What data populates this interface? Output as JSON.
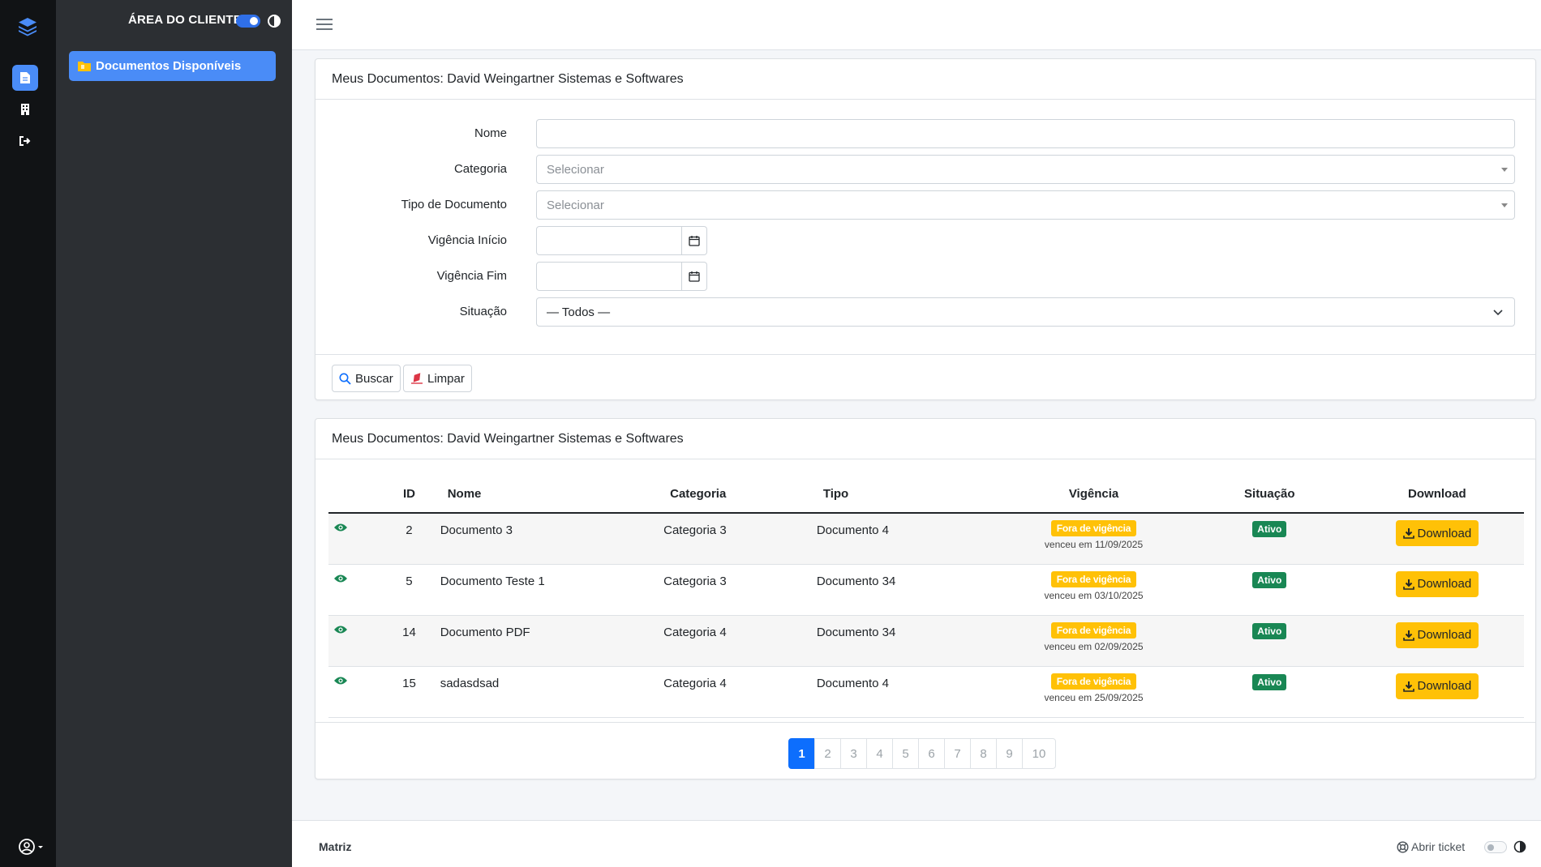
{
  "sidebar": {
    "title": "ÁREA DO CLIENTE",
    "nav_item": "Documentos Disponíveis"
  },
  "filters": {
    "header": "Meus Documentos: David Weingartner Sistemas e Softwares",
    "nome_label": "Nome",
    "nome_value": "",
    "categoria_label": "Categoria",
    "categoria_value": "Selecionar",
    "tipo_label": "Tipo de Documento",
    "tipo_value": "Selecionar",
    "vig_inicio_label": "Vigência Início",
    "vig_fim_label": "Vigência Fim",
    "situacao_label": "Situação",
    "situacao_value": "— Todos —",
    "buscar": "Buscar",
    "limpar": "Limpar"
  },
  "table": {
    "header": "Meus Documentos: David Weingartner Sistemas e Softwares",
    "columns": [
      "ID",
      "Nome",
      "Categoria",
      "Tipo",
      "Vigência",
      "Situação",
      "Download"
    ],
    "rows": [
      {
        "id": "2",
        "nome": "Documento 3",
        "categoria": "Categoria 3",
        "tipo": "Documento 4",
        "vig_badge": "Fora de vigência",
        "vig_sub": "venceu em 11/09/2025",
        "situacao": "Ativo",
        "download": "Download"
      },
      {
        "id": "5",
        "nome": "Documento Teste 1",
        "categoria": "Categoria 3",
        "tipo": "Documento 34",
        "vig_badge": "Fora de vigência",
        "vig_sub": "venceu em 03/10/2025",
        "situacao": "Ativo",
        "download": "Download"
      },
      {
        "id": "14",
        "nome": "Documento PDF",
        "categoria": "Categoria 4",
        "tipo": "Documento 34",
        "vig_badge": "Fora de vigência",
        "vig_sub": "venceu em 02/09/2025",
        "situacao": "Ativo",
        "download": "Download"
      },
      {
        "id": "15",
        "nome": "sadasdsad",
        "categoria": "Categoria 4",
        "tipo": "Documento 4",
        "vig_badge": "Fora de vigência",
        "vig_sub": "venceu em 25/09/2025",
        "situacao": "Ativo",
        "download": "Download"
      }
    ],
    "pages": [
      "1",
      "2",
      "3",
      "4",
      "5",
      "6",
      "7",
      "8",
      "9",
      "10"
    ],
    "active_page": "1"
  },
  "footer": {
    "left": "Matriz",
    "ticket": "Abrir ticket"
  },
  "colors": {
    "accent": "#4a8cf7",
    "warning": "#ffc107",
    "success": "#198754",
    "primary": "#0d6efd"
  }
}
